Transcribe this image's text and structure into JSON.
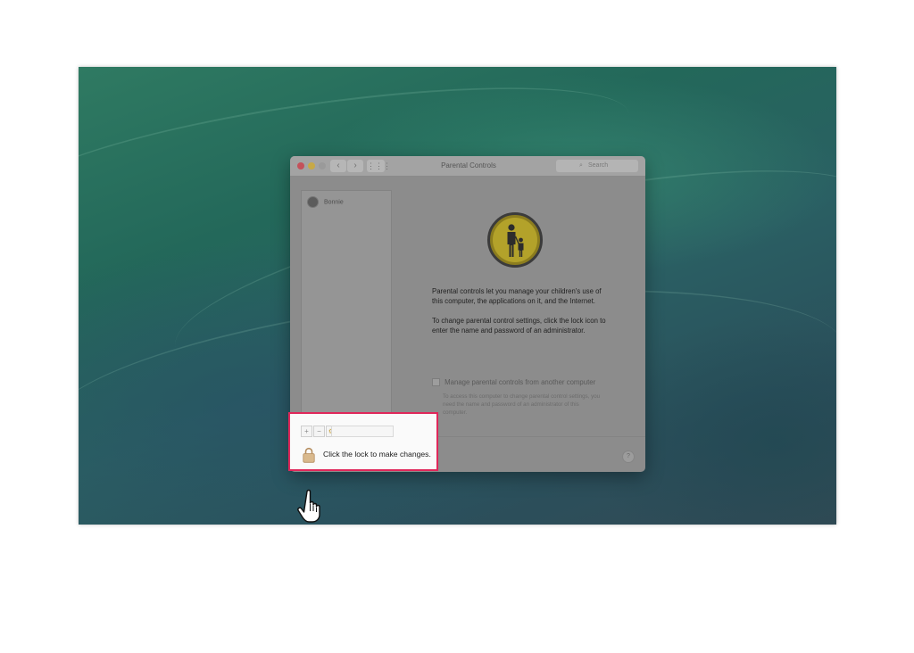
{
  "window": {
    "title": "Parental Controls",
    "back_label": "‹",
    "forward_label": "›",
    "grid_label": "⋮⋮⋮",
    "search_placeholder": "Search",
    "search_icon": "search-icon"
  },
  "sidebar": {
    "users": [
      {
        "name": "Bonnie",
        "icon": "user-avatar-icon"
      }
    ]
  },
  "main": {
    "badge_icon": "parent-child-icon",
    "badge_color": "#f2d33c",
    "paragraph1": "Parental controls let you manage your children's use of this computer, the applications on it, and the Internet.",
    "paragraph2": "To change parental control settings, click the lock icon to enter the name and password of an administrator.",
    "remote_checkbox_label": "Manage parental controls from another computer",
    "remote_checkbox_checked": false,
    "remote_subtext": "To access this computer to change parental control settings, you need the name and password of an administrator of this computer.",
    "help_label": "?"
  },
  "highlight_panel": {
    "border_color": "#e0275a",
    "add_label": "+",
    "remove_label": "−",
    "gear_icon": "gear-icon",
    "lock_icon": "lock-icon",
    "lock_text": "Click the lock to make changes."
  },
  "cursor": {
    "icon": "hand-pointer-icon"
  }
}
